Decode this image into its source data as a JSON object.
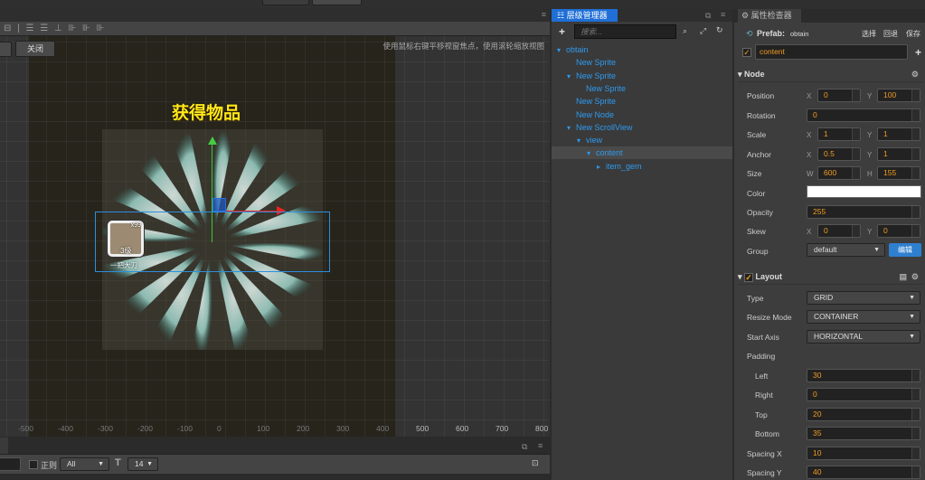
{
  "scene": {
    "close_label": "关闭",
    "hint": "使用鼠标右键平移视窗焦点，使用滚轮缩放视图",
    "title_text": "获得物品",
    "item": {
      "count": "x99",
      "level": "3级",
      "name": "一把大刀"
    },
    "ruler": [
      "-500",
      "-400",
      "-300",
      "-200",
      "-100",
      "0",
      "100",
      "200",
      "300",
      "400",
      "500",
      "600",
      "700",
      "800"
    ]
  },
  "console": {
    "regex_label": "正则",
    "filter": "All",
    "font_size": "14"
  },
  "hierarchy": {
    "tab": "层级管理器",
    "search_placeholder": "搜索...",
    "nodes": [
      {
        "label": "obtain",
        "depth": 0,
        "arrow": "▾"
      },
      {
        "label": "New Sprite",
        "depth": 1,
        "arrow": ""
      },
      {
        "label": "New Sprite",
        "depth": 1,
        "arrow": "▾"
      },
      {
        "label": "New Sprite",
        "depth": 2,
        "arrow": ""
      },
      {
        "label": "New Sprite",
        "depth": 1,
        "arrow": ""
      },
      {
        "label": "New Node",
        "depth": 1,
        "arrow": ""
      },
      {
        "label": "New ScrollView",
        "depth": 1,
        "arrow": "▾"
      },
      {
        "label": "view",
        "depth": 2,
        "arrow": "▾"
      },
      {
        "label": "content",
        "depth": 3,
        "arrow": "▾",
        "selected": true
      },
      {
        "label": "item_gem",
        "depth": 4,
        "arrow": "▸"
      }
    ]
  },
  "inspector": {
    "tab": "属性检查器",
    "prefab_label": "Prefab:",
    "prefab_name": "obtain",
    "select": "选择",
    "revert": "回退",
    "save": "保存",
    "node_name": "content",
    "node_section": "Node",
    "position": {
      "label": "Position",
      "x": "0",
      "y": "100"
    },
    "rotation": {
      "label": "Rotation",
      "value": "0"
    },
    "scale": {
      "label": "Scale",
      "x": "1",
      "y": "1"
    },
    "anchor": {
      "label": "Anchor",
      "x": "0.5",
      "y": "1"
    },
    "size": {
      "label": "Size",
      "w": "600",
      "h": "155"
    },
    "color": {
      "label": "Color",
      "value": "#ffffff"
    },
    "opacity": {
      "label": "Opacity",
      "value": "255"
    },
    "skew": {
      "label": "Skew",
      "x": "0",
      "y": "0"
    },
    "group": {
      "label": "Group",
      "value": "default",
      "edit": "编辑"
    },
    "layout_section": "Layout",
    "type": {
      "label": "Type",
      "value": "GRID"
    },
    "resize_mode": {
      "label": "Resize Mode",
      "value": "CONTAINER"
    },
    "start_axis": {
      "label": "Start Axis",
      "value": "HORIZONTAL"
    },
    "padding": {
      "label": "Padding",
      "left_label": "Left",
      "left": "30",
      "right_label": "Right",
      "right": "0",
      "top_label": "Top",
      "top": "20",
      "bottom_label": "Bottom",
      "bottom": "35"
    },
    "spacing_x": {
      "label": "Spacing X",
      "value": "10"
    },
    "spacing_y": {
      "label": "Spacing Y",
      "value": "40"
    },
    "axis": {
      "x": "X",
      "y": "Y",
      "w": "W",
      "h": "H"
    }
  }
}
